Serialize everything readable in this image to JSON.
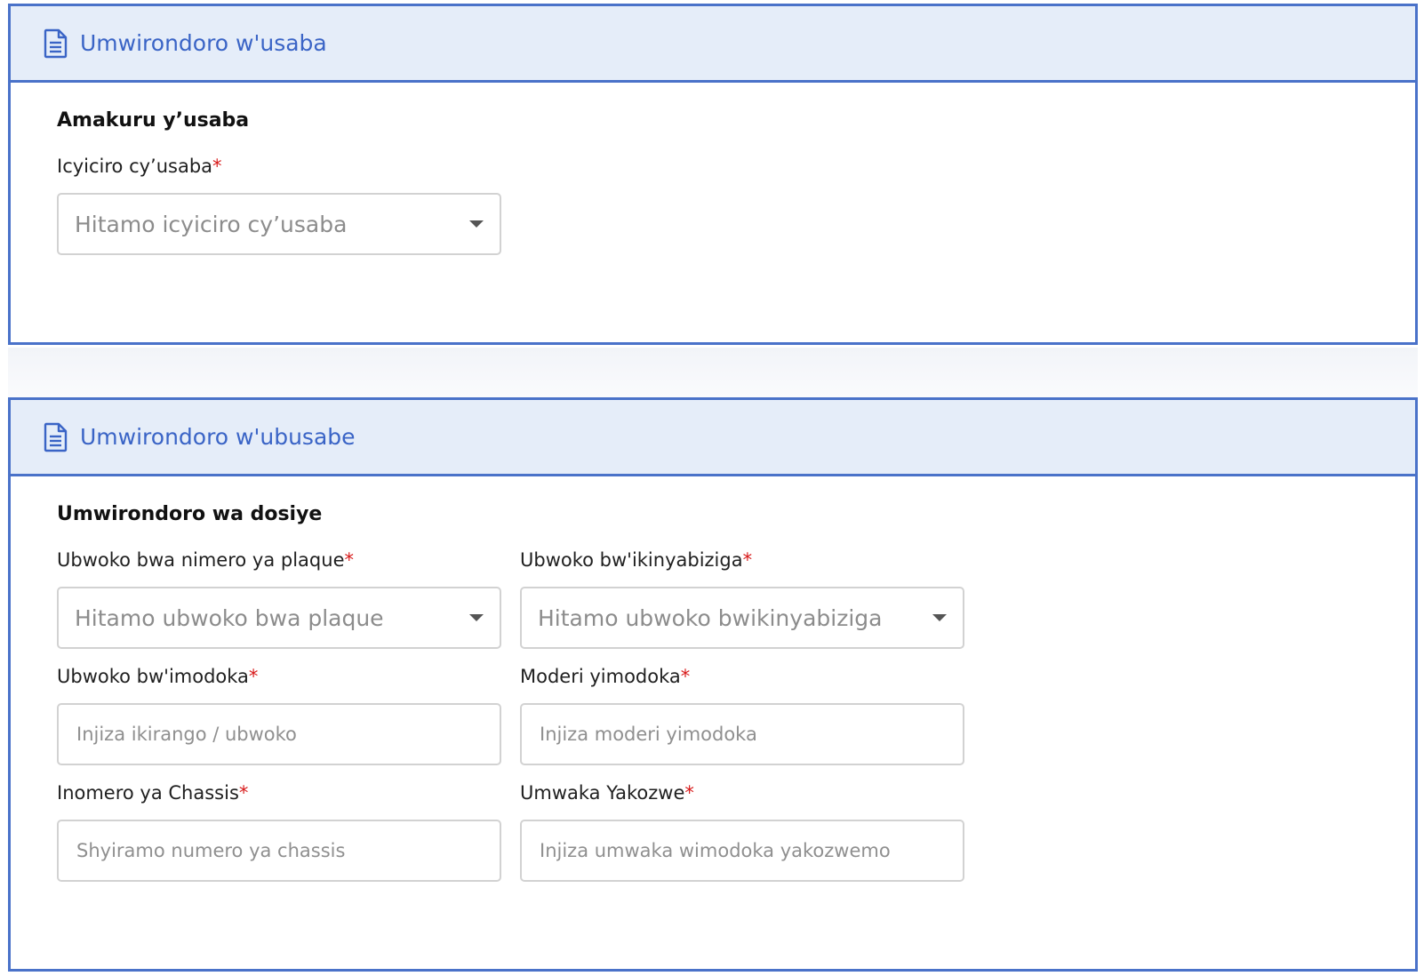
{
  "sections": [
    {
      "header_title": "Umwirondoro w'usaba",
      "subtitle": "Amakuru y’usaba",
      "fields": [
        {
          "label": "Icyiciro cy’usaba",
          "required_mark": "*",
          "type": "select",
          "placeholder": "Hitamo icyiciro cy’usaba"
        }
      ]
    },
    {
      "header_title": "Umwirondoro w'ubusabe",
      "subtitle": "Umwirondoro wa dosiye",
      "fields": [
        {
          "label": "Ubwoko bwa nimero ya plaque",
          "required_mark": "*",
          "type": "select",
          "placeholder": "Hitamo ubwoko bwa plaque"
        },
        {
          "label": "Ubwoko bw'ikinyabiziga",
          "required_mark": "*",
          "type": "select",
          "placeholder": "Hitamo ubwoko bwikinyabiziga"
        },
        {
          "label": "Ubwoko bw'imodoka",
          "required_mark": "*",
          "type": "input",
          "placeholder": "Injiza ikirango / ubwoko"
        },
        {
          "label": "Moderi yimodoka",
          "required_mark": "*",
          "type": "input",
          "placeholder": "Injiza moderi yimodoka"
        },
        {
          "label": "Inomero ya Chassis",
          "required_mark": "*",
          "type": "input",
          "placeholder": "Shyiramo numero ya chassis"
        },
        {
          "label": "Umwaka Yakozwe",
          "required_mark": "*",
          "type": "input",
          "placeholder": "Injiza umwaka wimodoka yakozwemo"
        }
      ]
    }
  ],
  "icons": {
    "header_icon": "document-icon",
    "select_caret": "caret-down-icon"
  },
  "colors": {
    "accent": "#4a72c9",
    "header_bg": "#e5edf9",
    "header_text": "#3a64c6",
    "required": "#d81b1b"
  }
}
